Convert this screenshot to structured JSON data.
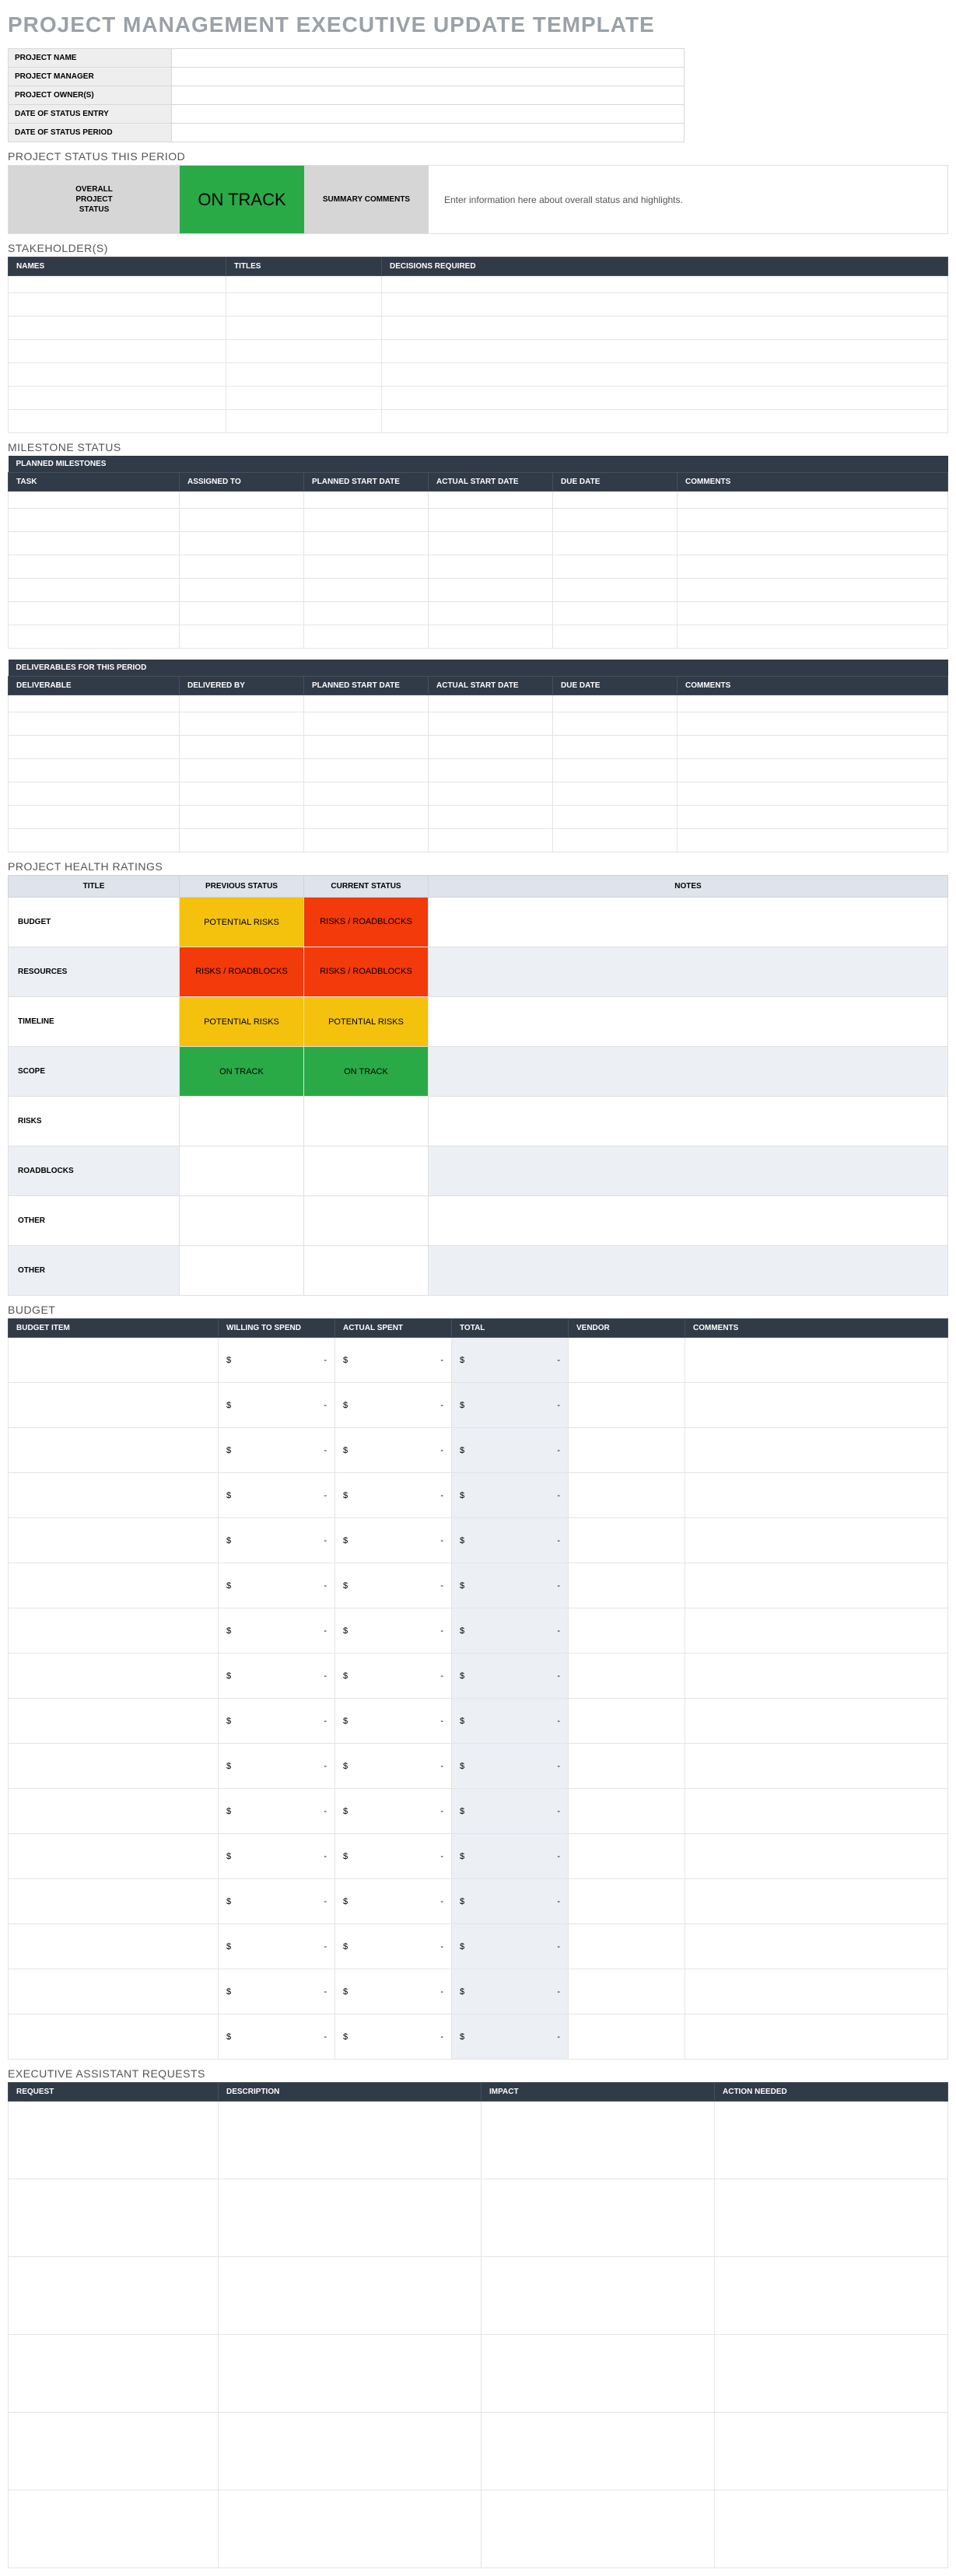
{
  "title": "PROJECT MANAGEMENT EXECUTIVE UPDATE TEMPLATE",
  "info": {
    "rows": [
      "PROJECT NAME",
      "PROJECT MANAGER",
      "PROJECT OWNER(S)",
      "DATE OF STATUS ENTRY",
      "DATE OF STATUS PERIOD"
    ]
  },
  "status_section": {
    "heading": "PROJECT STATUS THIS PERIOD",
    "overall_label": "OVERALL\nPROJECT\nSTATUS",
    "overall_value": "ON TRACK",
    "summary_label": "SUMMARY COMMENTS",
    "summary_text": "Enter information here about overall status and highlights."
  },
  "stakeholders": {
    "heading": "STAKEHOLDER(S)",
    "cols": [
      "NAMES",
      "TITLES",
      "DECISIONS REQUIRED"
    ],
    "row_count": 7
  },
  "milestones": {
    "heading": "MILESTONE STATUS",
    "band": "PLANNED MILESTONES",
    "cols": [
      "TASK",
      "ASSIGNED TO",
      "PLANNED START DATE",
      "ACTUAL START DATE",
      "DUE DATE",
      "COMMENTS"
    ],
    "row_count": 7
  },
  "deliverables": {
    "band": "DELIVERABLES FOR THIS PERIOD",
    "cols": [
      "DELIVERABLE",
      "DELIVERED BY",
      "PLANNED START DATE",
      "ACTUAL START DATE",
      "DUE DATE",
      "COMMENTS"
    ],
    "row_count": 7
  },
  "health": {
    "heading": "PROJECT HEALTH RATINGS",
    "cols": [
      "TITLE",
      "PREVIOUS STATUS",
      "CURRENT STATUS",
      "NOTES"
    ],
    "rows": [
      {
        "title": "BUDGET",
        "prev": "POTENTIAL RISKS",
        "prev_cls": "yellow-cell",
        "curr": "RISKS / ROADBLOCKS",
        "curr_cls": "red-cell",
        "alt": false
      },
      {
        "title": "RESOURCES",
        "prev": "RISKS / ROADBLOCKS",
        "prev_cls": "red-cell",
        "curr": "RISKS / ROADBLOCKS",
        "curr_cls": "red-cell",
        "alt": true
      },
      {
        "title": "TIMELINE",
        "prev": "POTENTIAL RISKS",
        "prev_cls": "yellow-cell",
        "curr": "POTENTIAL RISKS",
        "curr_cls": "yellow-cell",
        "alt": false
      },
      {
        "title": "SCOPE",
        "prev": "ON TRACK",
        "prev_cls": "green-cell",
        "curr": "ON TRACK",
        "curr_cls": "green-cell",
        "alt": true
      },
      {
        "title": "RISKS",
        "prev": "",
        "prev_cls": "",
        "curr": "",
        "curr_cls": "",
        "alt": false
      },
      {
        "title": "ROADBLOCKS",
        "prev": "",
        "prev_cls": "",
        "curr": "",
        "curr_cls": "",
        "alt": true
      },
      {
        "title": "OTHER",
        "prev": "",
        "prev_cls": "",
        "curr": "",
        "curr_cls": "",
        "alt": false
      },
      {
        "title": "OTHER",
        "prev": "",
        "prev_cls": "",
        "curr": "",
        "curr_cls": "",
        "alt": true
      }
    ]
  },
  "budget": {
    "heading": "BUDGET",
    "cols": [
      "BUDGET ITEM",
      "WILLING TO SPEND",
      "ACTUAL SPENT",
      "TOTAL",
      "VENDOR",
      "COMMENTS"
    ],
    "sym": "$",
    "dash": "-",
    "row_count": 16
  },
  "exec": {
    "heading": "EXECUTIVE ASSISTANT REQUESTS",
    "cols": [
      "REQUEST",
      "DESCRIPTION",
      "IMPACT",
      "ACTION NEEDED"
    ],
    "row_count": 6
  }
}
